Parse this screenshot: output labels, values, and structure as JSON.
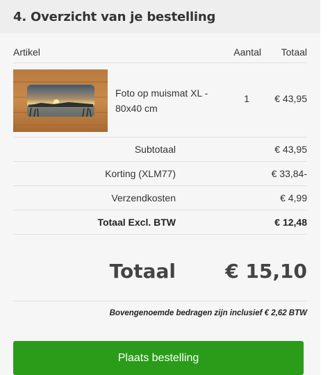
{
  "section": {
    "title": "4. Overzicht van je bestelling"
  },
  "table": {
    "headers": {
      "artikel": "Artikel",
      "aantal": "Aantal",
      "totaal": "Totaal"
    },
    "item": {
      "name": "Foto op muismat XL - 80x40 cm",
      "quantity": "1",
      "price": "€ 43,95",
      "image": "mousepad-sunset-photo"
    }
  },
  "summary": {
    "subtotal_label": "Subtotaal",
    "subtotal_value": "€ 43,95",
    "discount_label": "Korting (XLM77)",
    "discount_value": "€ 33,84-",
    "shipping_label": "Verzendkosten",
    "shipping_value": "€ 4,99",
    "total_excl_label": "Totaal Excl. BTW",
    "total_excl_value": "€ 12,48"
  },
  "grand_total": {
    "label": "Totaal",
    "value": "€ 15,10"
  },
  "vat_note": "Bovengenoemde bedragen zijn inclusief € 2,62 BTW",
  "place_order_label": "Plaats bestelling",
  "colors": {
    "button": "#2a9c1a",
    "header_bg": "#eeeeee",
    "panel_bg": "#f6f6f6"
  }
}
